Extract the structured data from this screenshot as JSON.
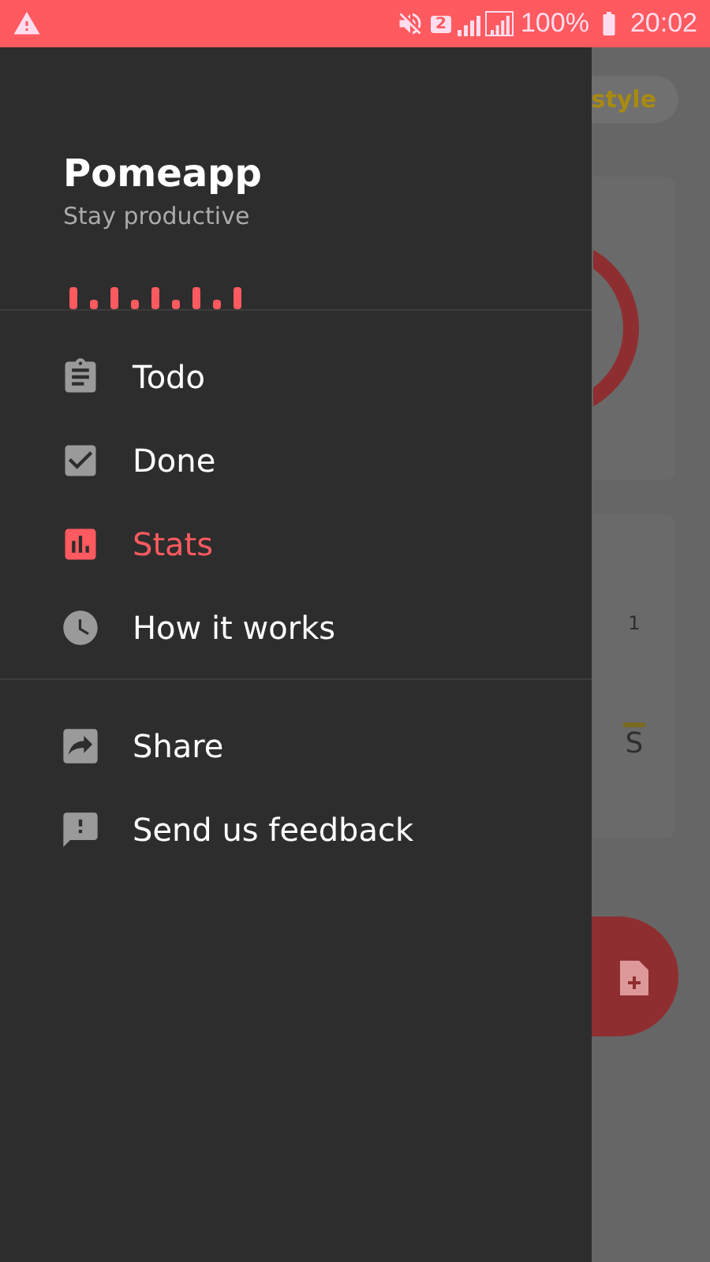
{
  "status_bar": {
    "sim": "2",
    "battery": "100%",
    "time": "20:02"
  },
  "background": {
    "style_chip": "style",
    "axis_label": "1",
    "day_label": "S"
  },
  "drawer": {
    "title": "Pomeapp",
    "subtitle": "Stay productive",
    "sections": [
      {
        "items": [
          {
            "kind": "todo",
            "label": "Todo",
            "selected": false
          },
          {
            "kind": "done",
            "label": "Done",
            "selected": false
          },
          {
            "kind": "stats",
            "label": "Stats",
            "selected": true
          },
          {
            "kind": "how",
            "label": "How it works",
            "selected": false
          }
        ]
      },
      {
        "items": [
          {
            "kind": "share",
            "label": "Share",
            "selected": false
          },
          {
            "kind": "feedback",
            "label": "Send us feedback",
            "selected": false
          }
        ]
      }
    ]
  }
}
